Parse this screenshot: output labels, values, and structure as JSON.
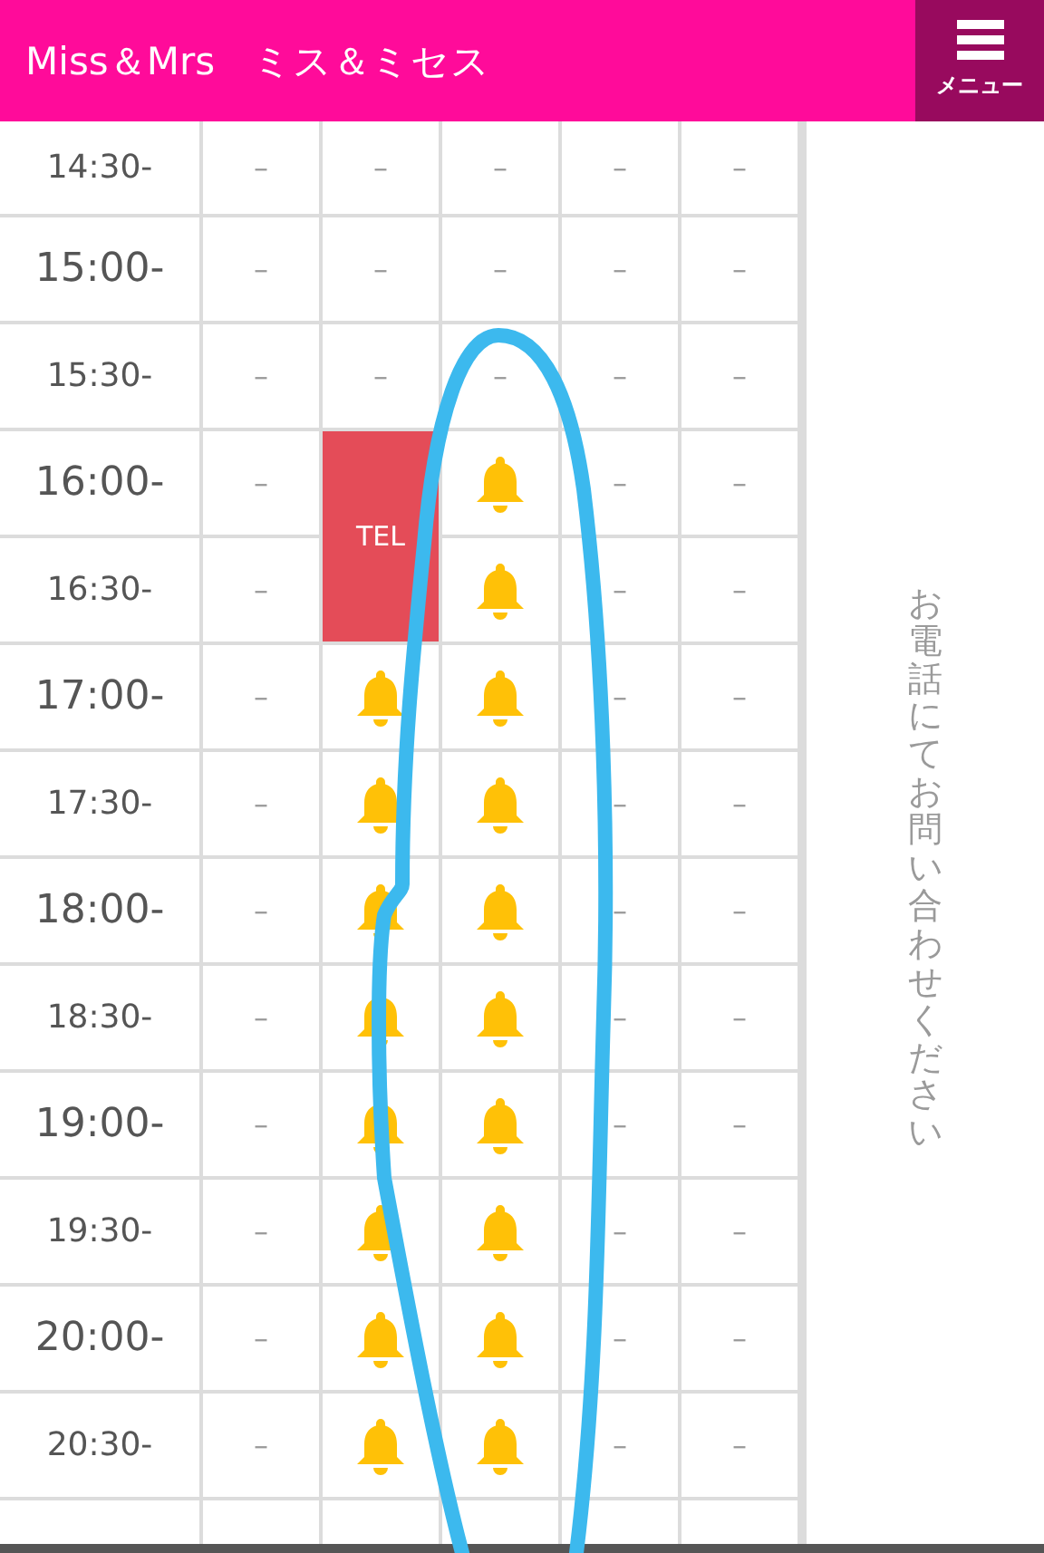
{
  "header": {
    "title": "Miss＆Mrs　ミス＆ミセス",
    "menu_label": "メニュー"
  },
  "rows": [
    {
      "time": "14:30-",
      "kind": "half",
      "cells": [
        {
          "kind": "dash",
          "text": "–"
        },
        {
          "kind": "dash",
          "text": "–"
        },
        {
          "kind": "dash",
          "text": "–"
        },
        {
          "kind": "dash",
          "text": "–"
        },
        {
          "kind": "dash",
          "text": "–"
        }
      ]
    },
    {
      "time": "15:00-",
      "kind": "hour",
      "cells": [
        {
          "kind": "dash",
          "text": "–"
        },
        {
          "kind": "dash",
          "text": "–"
        },
        {
          "kind": "dash",
          "text": "–"
        },
        {
          "kind": "dash",
          "text": "–"
        },
        {
          "kind": "dash",
          "text": "–"
        }
      ]
    },
    {
      "time": "15:30-",
      "kind": "half",
      "cells": [
        {
          "kind": "dash",
          "text": "–"
        },
        {
          "kind": "dash",
          "text": "–"
        },
        {
          "kind": "dash",
          "text": "–"
        },
        {
          "kind": "dash",
          "text": "–"
        },
        {
          "kind": "dash",
          "text": "–"
        }
      ]
    },
    {
      "time": "16:00-",
      "kind": "hour",
      "cells": [
        {
          "kind": "dash",
          "text": "–"
        },
        {
          "kind": "tel",
          "text": "TEL"
        },
        {
          "kind": "bell"
        },
        {
          "kind": "dash",
          "text": "–"
        },
        {
          "kind": "dash",
          "text": "–"
        }
      ]
    },
    {
      "time": "16:30-",
      "kind": "half",
      "cells": [
        {
          "kind": "dash",
          "text": "–"
        },
        {
          "kind": "bell"
        },
        {
          "kind": "dash",
          "text": "–"
        },
        {
          "kind": "dash",
          "text": "–"
        }
      ]
    },
    {
      "time": "17:00-",
      "kind": "hour",
      "cells": [
        {
          "kind": "dash",
          "text": "–"
        },
        {
          "kind": "bell"
        },
        {
          "kind": "bell"
        },
        {
          "kind": "dash",
          "text": "–"
        },
        {
          "kind": "dash",
          "text": "–"
        }
      ]
    },
    {
      "time": "17:30-",
      "kind": "half",
      "cells": [
        {
          "kind": "dash",
          "text": "–"
        },
        {
          "kind": "bell"
        },
        {
          "kind": "bell"
        },
        {
          "kind": "dash",
          "text": "–"
        },
        {
          "kind": "dash",
          "text": "–"
        }
      ]
    },
    {
      "time": "18:00-",
      "kind": "hour",
      "cells": [
        {
          "kind": "dash",
          "text": "–"
        },
        {
          "kind": "bell"
        },
        {
          "kind": "bell"
        },
        {
          "kind": "dash",
          "text": "–"
        },
        {
          "kind": "dash",
          "text": "–"
        }
      ]
    },
    {
      "time": "18:30-",
      "kind": "half",
      "cells": [
        {
          "kind": "dash",
          "text": "–"
        },
        {
          "kind": "bell"
        },
        {
          "kind": "bell"
        },
        {
          "kind": "dash",
          "text": "–"
        },
        {
          "kind": "dash",
          "text": "–"
        }
      ]
    },
    {
      "time": "19:00-",
      "kind": "hour",
      "cells": [
        {
          "kind": "dash",
          "text": "–"
        },
        {
          "kind": "bell"
        },
        {
          "kind": "bell"
        },
        {
          "kind": "dash",
          "text": "–"
        },
        {
          "kind": "dash",
          "text": "–"
        }
      ]
    },
    {
      "time": "19:30-",
      "kind": "half",
      "cells": [
        {
          "kind": "dash",
          "text": "–"
        },
        {
          "kind": "bell"
        },
        {
          "kind": "bell"
        },
        {
          "kind": "dash",
          "text": "–"
        },
        {
          "kind": "dash",
          "text": "–"
        }
      ]
    },
    {
      "time": "20:00-",
      "kind": "hour",
      "cells": [
        {
          "kind": "dash",
          "text": "–"
        },
        {
          "kind": "bell"
        },
        {
          "kind": "bell"
        },
        {
          "kind": "dash",
          "text": "–"
        },
        {
          "kind": "dash",
          "text": "–"
        }
      ]
    },
    {
      "time": "20:30-",
      "kind": "half",
      "cells": [
        {
          "kind": "dash",
          "text": "–"
        },
        {
          "kind": "bell"
        },
        {
          "kind": "bell"
        },
        {
          "kind": "dash",
          "text": "–"
        },
        {
          "kind": "dash",
          "text": "–"
        }
      ]
    }
  ],
  "side_note": "お電話にてお問い合わせください"
}
